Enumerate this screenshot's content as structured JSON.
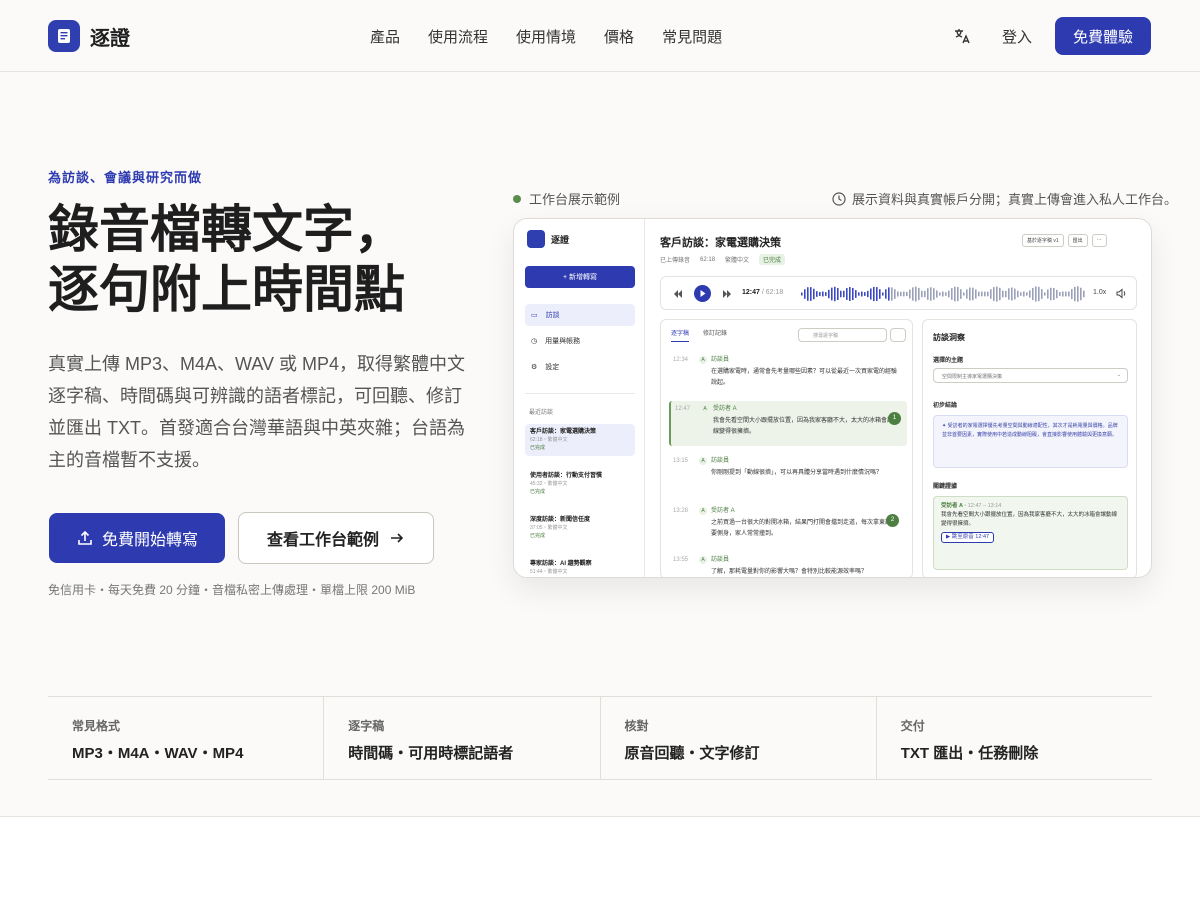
{
  "header": {
    "brand": "逐證",
    "nav": [
      "產品",
      "使用流程",
      "使用情境",
      "價格",
      "常見問題"
    ],
    "login": "登入",
    "cta": "免費體驗"
  },
  "hero": {
    "eyebrow": "為訪談、會議與研究而做",
    "title_line1": "錄音檔轉文字，",
    "title_line2": "逐句附上時間點",
    "lead": "真實上傳 MP3、M4A、WAV 或 MP4，取得繁體中文逐字稿、時間碼與可辨識的語者標記，可回聽、修訂並匯出 TXT。首發適合台灣華語與中英夾雜；台語為主的音檔暫不支援。",
    "primary_button": "免費開始轉寫",
    "secondary_button": "查看工作台範例",
    "fine_print": "免信用卡・每天免費 20 分鐘・音檔私密上傳處理・單檔上限 200 MiB"
  },
  "demo": {
    "label": "工作台展示範例",
    "note": "展示資料與真實帳戶分開；真實上傳會進入私人工作台。",
    "sidebar": {
      "brand": "逐證",
      "new_button": "+ 新增轉寫",
      "nav": [
        "訪談",
        "用量與帳務",
        "設定"
      ],
      "recent_heading": "最近訪談",
      "items": [
        {
          "title": "客戶訪談：家電選購決策",
          "sub": "62:18・繁體中文",
          "status": "已完成"
        },
        {
          "title": "使用者訪談：行動支付習慣",
          "sub": "45:32・繁體中文",
          "status": "已完成"
        },
        {
          "title": "深度訪談：新聞信任度",
          "sub": "37:05・繁體中文",
          "status": "已完成"
        },
        {
          "title": "專家訪談：AI 趨勢觀察",
          "sub": "51:44・繁體中文",
          "status": ""
        }
      ]
    },
    "main": {
      "title": "客戶訪談：家電選購決策",
      "uploaded": "已上傳錄音",
      "duration": "62:18",
      "language": "繁體中文",
      "status": "已完成",
      "version": "基於逐字稿 v1",
      "export": "匯出",
      "more": "···",
      "player": {
        "current": "12:47",
        "total": "/ 62:18",
        "speed": "1.0x"
      },
      "tabs": [
        "逐字稿",
        "修訂記錄"
      ],
      "search_placeholder": "搜尋逐字稿",
      "segments": [
        {
          "time": "12:34",
          "speaker": "訪談員",
          "text": "在選購家電時，通常會先考量哪些因素？可以從最近一次買家電的經驗說起。"
        },
        {
          "time": "12:47",
          "speaker": "受訪者 A",
          "text": "我會先看空間大小跟擺放位置，因為我家客廳不大，太大的冰箱會讓動線變得很擁擠。",
          "badge": "1"
        },
        {
          "time": "13:15",
          "speaker": "訪談員",
          "text": "你剛剛提到「動線很擠」，可以再具體分享當時遇到什麼情況嗎？"
        },
        {
          "time": "13:28",
          "speaker": "受訪者 A",
          "text": "之前買過一台很大的對開冰箱，結果門打開會擋到走道，每次拿東西都要側身，家人常常撞到。",
          "badge": "2"
        },
        {
          "time": "13:55",
          "speaker": "訪談員",
          "text": "了解，那耗電量對你的影響大嗎？會特別比較能源效率嗎？"
        }
      ]
    },
    "insights": {
      "title": "訪談洞察",
      "topic_label": "選擇的主題",
      "topic_value": "空間限制主導家電選購決策",
      "summary_label": "初步結論",
      "summary": "受訪者的家電選擇優先考量空間與動線適配性，其次才是耗電量與價格。品牌並非首要因素，實際使用中若造成動線阻礙，會直接影響使用體驗與更換意願。",
      "evidence_label": "關鍵證據",
      "evidence_speaker": "受訪者 A",
      "evidence_range": "12:47 – 13:14",
      "evidence_text": "我會先看空間大小跟擺放位置，因為我家客廳不大，太大的冰箱會讓動線變得很擁擠。",
      "jump": "跳至原音 12:47"
    }
  },
  "stats": [
    {
      "label": "常見格式",
      "value": "MP3・M4A・WAV・MP4"
    },
    {
      "label": "逐字稿",
      "value": "時間碼・可用時標記語者"
    },
    {
      "label": "核對",
      "value": "原音回聽・文字修訂"
    },
    {
      "label": "交付",
      "value": "TXT 匯出・任務刪除"
    }
  ],
  "colors": {
    "accent": "#2e3bb0",
    "success": "#4d7f42",
    "background": "#fbfaf8"
  }
}
